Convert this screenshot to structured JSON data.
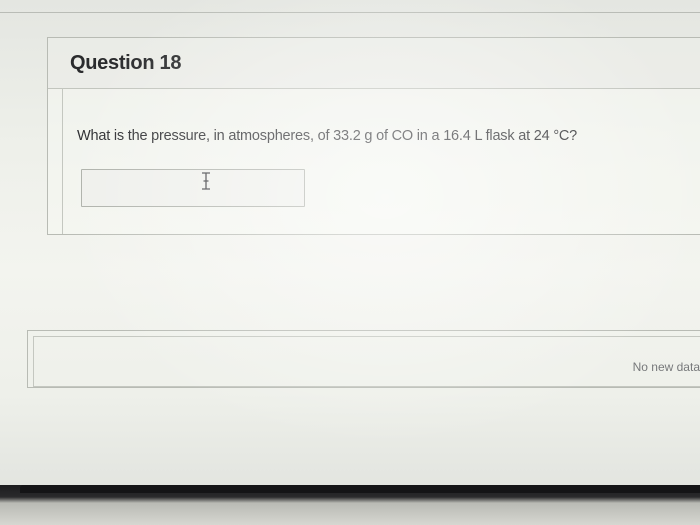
{
  "question": {
    "title": "Question 18",
    "text": "What is the pressure, in atmospheres, of 33.2 g of CO in a 16.4 L flask at 24 °C?",
    "answer_value": "",
    "answer_placeholder": ""
  },
  "status": {
    "text": "No new data"
  },
  "icons": {
    "cursor": "text-cursor-icon"
  }
}
